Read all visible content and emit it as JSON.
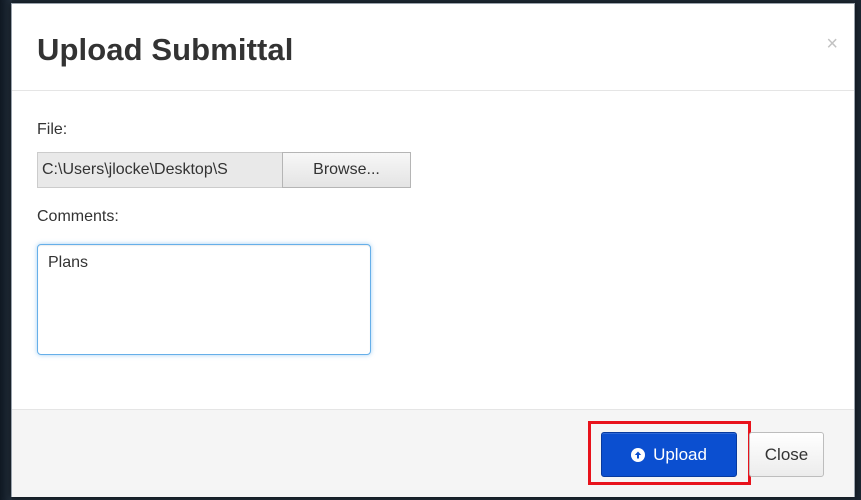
{
  "modal": {
    "title": "Upload Submittal",
    "close_glyph": "×"
  },
  "form": {
    "file_label": "File:",
    "file_path_value": "C:\\Users\\jlocke\\Desktop\\S",
    "browse_label": "Browse...",
    "comments_label": "Comments:",
    "comments_value": "Plans"
  },
  "footer": {
    "upload_label": "Upload",
    "upload_icon": "circle-arrow-up-icon",
    "close_label": "Close"
  },
  "colors": {
    "primary": "#0b4fd0",
    "highlight": "#e8121b",
    "focus_border": "#66afe9"
  }
}
